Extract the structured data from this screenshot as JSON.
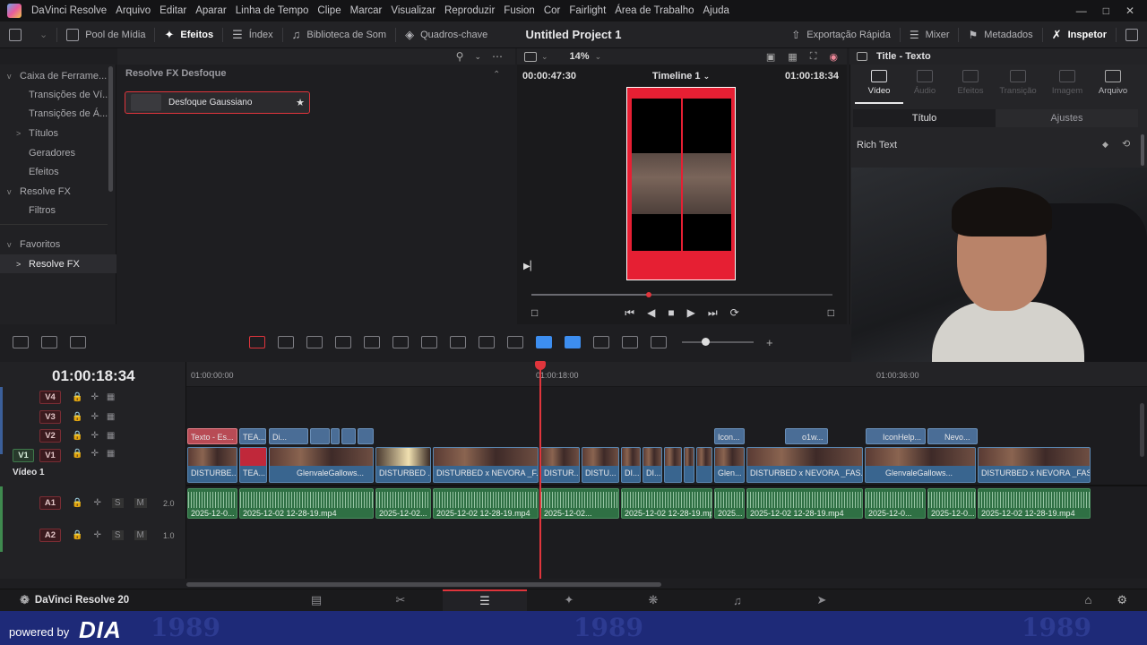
{
  "menu": {
    "app_name": "DaVinci Resolve",
    "items": [
      "Arquivo",
      "Editar",
      "Aparar",
      "Linha de Tempo",
      "Clipe",
      "Marcar",
      "Visualizar",
      "Reproduzir",
      "Fusion",
      "Cor",
      "Fairlight",
      "Área de Trabalho",
      "Ajuda"
    ]
  },
  "toolbar": {
    "media_pool": "Pool de Mídia",
    "effects": "Efeitos",
    "index": "Índex",
    "sound_library": "Biblioteca de Som",
    "keyframes": "Quadros-chave",
    "project_title": "Untitled Project 1",
    "quick_export": "Exportação Rápida",
    "mixer": "Mixer",
    "metadata": "Metadados",
    "inspector": "Inspetor"
  },
  "left_panel": {
    "items": [
      {
        "label": "Caixa de Ferrame...",
        "chevron": "v"
      },
      {
        "label": "Transições de Ví...",
        "chevron": ""
      },
      {
        "label": "Transições de Á...",
        "chevron": ""
      },
      {
        "label": "Títulos",
        "chevron": ">"
      },
      {
        "label": "Geradores",
        "chevron": ""
      },
      {
        "label": "Efeitos",
        "chevron": ""
      },
      {
        "label": "Resolve FX",
        "chevron": "v"
      },
      {
        "label": "Filtros",
        "chevron": ""
      },
      {
        "label": "Favoritos",
        "chevron": "v"
      },
      {
        "label": "Resolve FX",
        "chevron": ">"
      }
    ]
  },
  "effects_panel": {
    "heading": "Resolve FX Desfoque",
    "item_label": "Desfoque Gaussiano"
  },
  "viewer": {
    "zoom": "14%",
    "timecode_left": "00:00:47:30",
    "timeline_name": "Timeline 1",
    "timecode_right": "01:00:18:34",
    "playhead_progress": 0.39
  },
  "inspector": {
    "title": "Title - Texto",
    "tabs": [
      "Vídeo",
      "Áudio",
      "Efeitos",
      "Transição",
      "Imagem",
      "Arquivo"
    ],
    "subtabs": [
      "Título",
      "Ajustes"
    ],
    "section": "Rich Text"
  },
  "timeline": {
    "timecode": "01:00:18:34",
    "ruler": [
      "01:00:00:00",
      "01:00:18:00",
      "01:00:36:00"
    ],
    "tracks": [
      {
        "id": "V4",
        "label": ""
      },
      {
        "id": "V3",
        "label": ""
      },
      {
        "id": "V2",
        "label": ""
      },
      {
        "id": "V1",
        "label": "Vídeo 1"
      },
      {
        "id": "A1",
        "label": "",
        "level": "2.0"
      },
      {
        "id": "A2",
        "label": "",
        "level": "1.0"
      }
    ],
    "v2_clips": [
      "Texto - Es...",
      "TEA...",
      "Di...",
      "Icon...",
      "o1w...",
      "IconHelp...",
      "Nevo..."
    ],
    "v1_clips": [
      "DISTURBE...",
      "TEA...",
      "GlenvaleGallows...",
      "DISTURBED ...",
      "DISTURBED x NEVORA _F...",
      "DISTUR...",
      "DISTU...",
      "DI...",
      "DI...",
      "Glen...",
      "DISTURBED x NEVORA _FAS...",
      "GlenvaleGallows...",
      "DISTURBED x NEVORA _FAS..."
    ],
    "a1_clips": [
      "2025-12-0...",
      "2025-12-02 12-28-19.mp4",
      "2025-12-02...",
      "2025-12-02 12-28-19.mp4",
      "2025-12-02...",
      "2025-12-02 12-28-19.mp4",
      "2025...",
      "2025-12-02 12-28-19.mp4",
      "2025-12-0...",
      "2025-12-0...",
      "2025-12-02 12-28-19.mp4"
    ]
  },
  "pagebar": {
    "brand": "DaVinci Resolve 20"
  },
  "footer": {
    "powered": "powered by",
    "logo": "DIA",
    "pattern_text": "1989"
  },
  "colors": {
    "accent_red": "#e0353c",
    "video_clip": "#39658f",
    "audio_clip": "#2f7044",
    "preview_bg": "#e61f33",
    "footer_bg": "#1e2a78"
  }
}
